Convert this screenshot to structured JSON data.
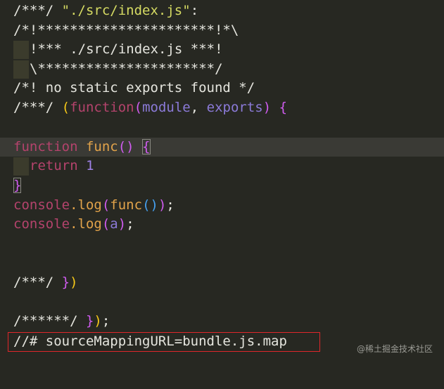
{
  "lines": {
    "l1_comment": "/***/",
    "l1_string": "\"./src/index.js\"",
    "l1_colon": ":",
    "l2": "/*!**********************!*\\",
    "l3": "!*** ./src/index.js ***!",
    "l4": "\\**********************/",
    "l5": "/*! no static exports found */",
    "l6_comment": "/***/",
    "l6_open_paren": "(",
    "l6_function": "function",
    "l6_paren_open": "(",
    "l6_module": "module",
    "l6_comma": ",",
    "l6_exports": "exports",
    "l6_paren_close": ")",
    "l6_brace": "{",
    "l8_function": "function",
    "l8_name": "func",
    "l8_parens": "()",
    "l8_brace": "{",
    "l9_return": "return",
    "l9_value": "1",
    "l10_brace": "}",
    "l11_console": "console",
    "l11_log": ".log",
    "l11_paren_open": "(",
    "l11_func": "func",
    "l11_inner_parens": "()",
    "l11_paren_close": ")",
    "l11_semi": ";",
    "l12_console": "console",
    "l12_log": ".log",
    "l12_paren_open": "(",
    "l12_arg": "a",
    "l12_paren_close": ")",
    "l12_semi": ";",
    "l15_comment": "/***/",
    "l15_brace": "}",
    "l15_paren": ")",
    "l17_comment": "/******/",
    "l17_brace": "}",
    "l17_paren": ")",
    "l17_semi": ";",
    "l18_sourcemap": "//# sourceMappingURL=bundle.js.map"
  },
  "watermark": "@稀土掘金技术社区",
  "colors": {
    "background": "#272822",
    "comment": "#e5e5de",
    "string": "#d6db63",
    "keyword": "#b4436c",
    "function_name": "#e2a34a",
    "parameter": "#8b7ad8",
    "number": "#9f82e8",
    "highlight_box": "#e0262a"
  }
}
